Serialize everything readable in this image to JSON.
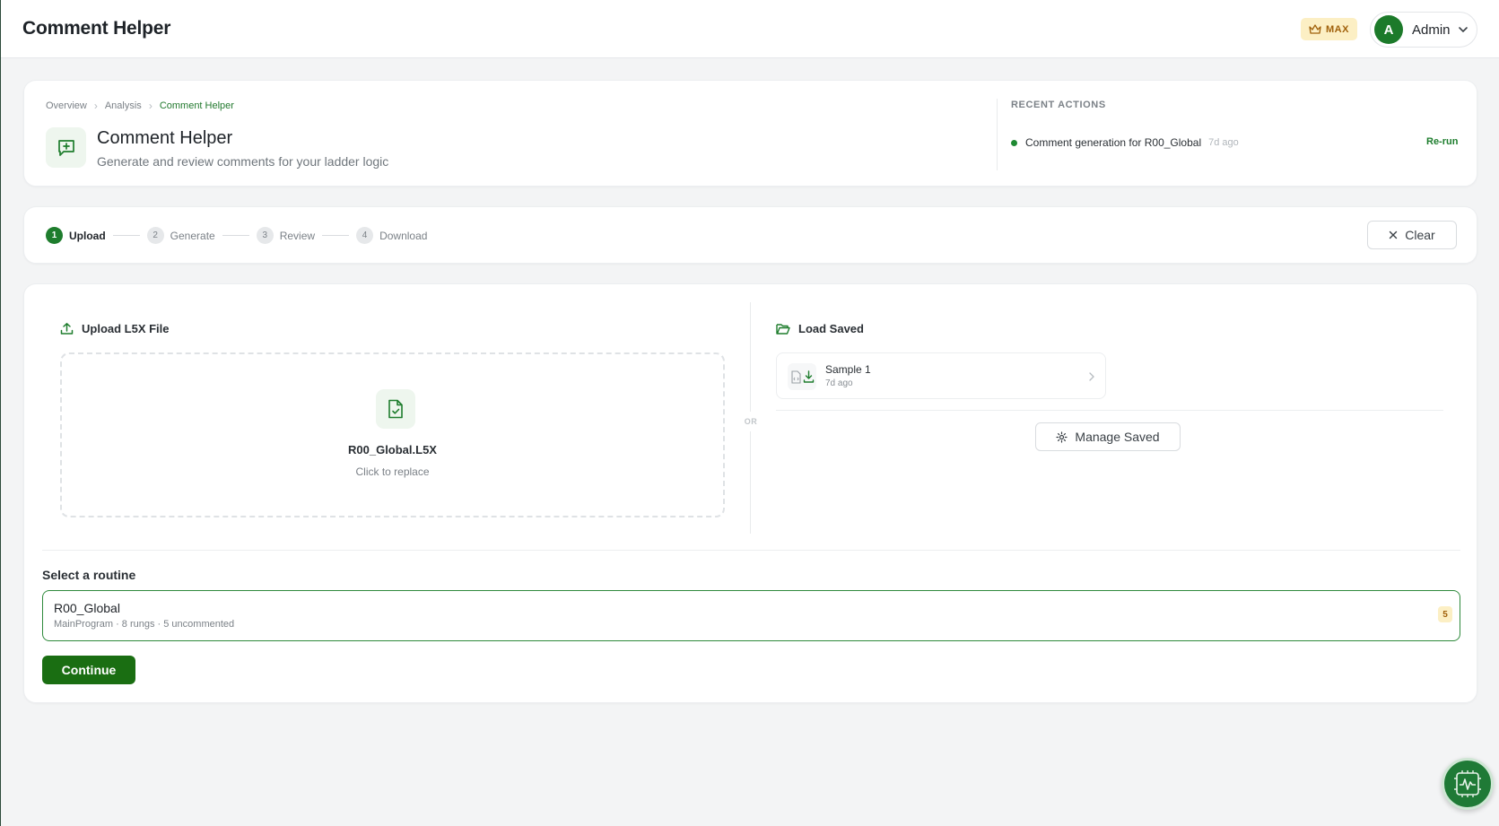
{
  "topbar": {
    "app_title": "Comment Helper",
    "plan_badge": "MAX",
    "user": {
      "avatar_letter": "A",
      "name": "Admin"
    }
  },
  "header": {
    "breadcrumb": [
      "Overview",
      "Analysis",
      "Comment Helper"
    ],
    "title": "Comment Helper",
    "subtitle": "Generate and review comments for your ladder logic",
    "recent_actions": {
      "heading": "RECENT ACTIONS",
      "items": [
        {
          "text": "Comment generation for R00_Global",
          "time": "7d ago",
          "action": "Re-run"
        }
      ]
    }
  },
  "stepper": {
    "steps": [
      {
        "num": "1",
        "label": "Upload"
      },
      {
        "num": "2",
        "label": "Generate"
      },
      {
        "num": "3",
        "label": "Review"
      },
      {
        "num": "4",
        "label": "Download"
      }
    ],
    "active_step": 1,
    "clear_label": "Clear"
  },
  "upload": {
    "title": "Upload L5X File",
    "file_name": "R00_Global.L5X",
    "hint": "Click to replace"
  },
  "divider_label": "OR",
  "load_saved": {
    "title": "Load Saved",
    "items": [
      {
        "name": "Sample 1",
        "time": "7d ago"
      }
    ],
    "manage_label": "Manage Saved"
  },
  "routine": {
    "label": "Select a routine",
    "options": [
      {
        "name": "R00_Global",
        "meta": "MainProgram · 8 rungs · 5 uncommented",
        "badge": "5"
      }
    ]
  },
  "continue_label": "Continue",
  "colors": {
    "accent": "#1e7d2d",
    "primary_button": "#1a6e12",
    "badge_bg": "#fcefc4",
    "badge_text": "#a0600a"
  }
}
